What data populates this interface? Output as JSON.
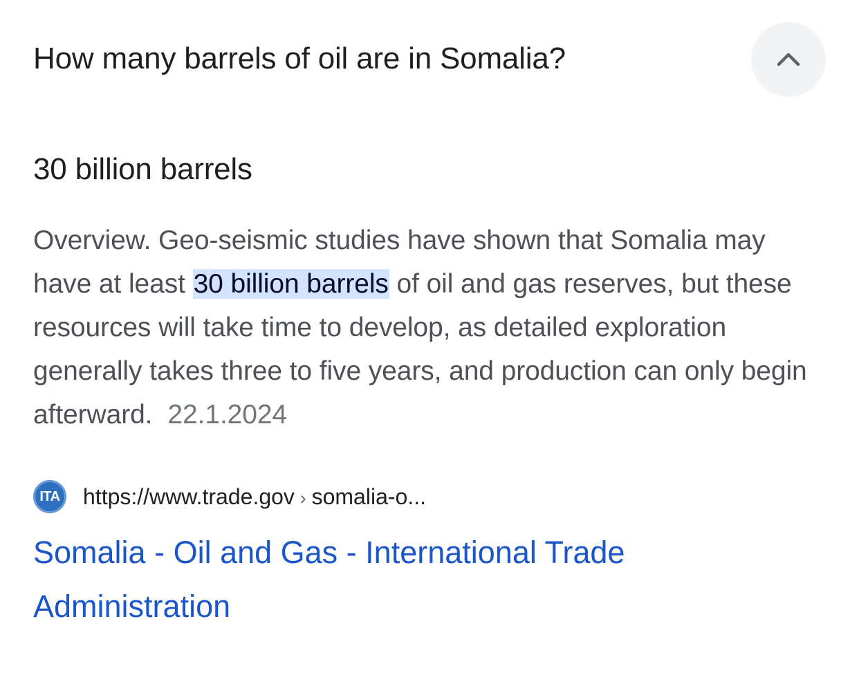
{
  "question": {
    "text": "How many barrels of oil are in Somalia?",
    "toggle_icon": "chevron-up-icon"
  },
  "answer": {
    "title": "30 billion barrels",
    "snippet_before": "Overview. Geo-seismic studies have shown that Somalia may have at least ",
    "snippet_highlight": "30 billion barrels",
    "snippet_after": " of oil and gas reserves, but these resources will take time to develop, as detailed exploration generally takes three to five years, and production can only begin afterward.",
    "date": "22.1.2024"
  },
  "source": {
    "favicon_text": "ITA",
    "url_base": "https://www.trade.gov",
    "url_separator": "›",
    "url_path": "somalia-o...",
    "title": "Somalia - Oil and Gas - International Trade Administration"
  },
  "colors": {
    "link": "#1a56c9",
    "highlight": "#d3e3fd",
    "favicon_bg": "#2f6fbf",
    "button_bg": "#f1f3f4"
  }
}
